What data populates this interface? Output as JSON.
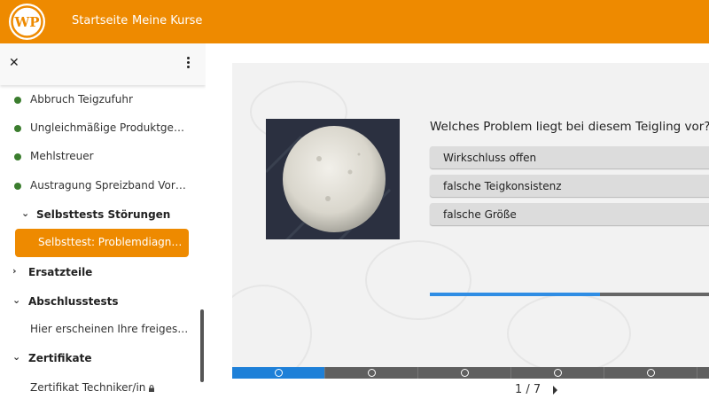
{
  "header": {
    "logo_text": "WP",
    "nav": [
      "Startseite",
      "Meine Kurse"
    ]
  },
  "sidebar": {
    "items": [
      {
        "label": "Abbruch Teigzufuhr",
        "status": "completed"
      },
      {
        "label": "Ungleichmäßige Produktgewic…",
        "status": "completed"
      },
      {
        "label": "Mehlstreuer",
        "status": "completed"
      },
      {
        "label": "Austragung Spreizband Vorbau",
        "status": "completed"
      }
    ],
    "subsection": "Selbsttests Störungen",
    "active_item": "Selbsttest: Problemdiagnos…",
    "sections": [
      {
        "label": "Ersatzteile",
        "expanded": false
      },
      {
        "label": "Abschlusstests",
        "expanded": true,
        "child": "Hier erscheinen Ihre freigesch…"
      },
      {
        "label": "Zertifikate",
        "expanded": true,
        "child": "Zertifikat Techniker/in"
      }
    ]
  },
  "quiz": {
    "question": "Welches Problem liegt bei diesem Teigling vor?",
    "answers": [
      "Wirkschluss offen",
      "falsche Teigkonsistenz",
      "falsche Größe"
    ],
    "progress": 0.6
  },
  "pager": {
    "current": 1,
    "total": 7,
    "text": "1 / 7"
  },
  "colors": {
    "brand": "#ee8a00",
    "completed": "#3b7d2e",
    "progress": "#2f8de4"
  }
}
